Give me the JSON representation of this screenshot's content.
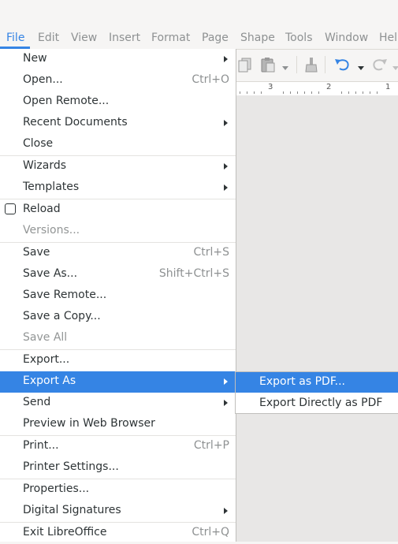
{
  "menubar": {
    "items": [
      "File",
      "Edit",
      "View",
      "Insert",
      "Format",
      "Page",
      "Shape",
      "Tools",
      "Window",
      "Hel"
    ]
  },
  "ruler": {
    "labels": [
      "3",
      "2",
      "1"
    ]
  },
  "file_menu": {
    "items": [
      {
        "label": "New",
        "submenu": true
      },
      {
        "label": "Open...",
        "accel": "Ctrl+O"
      },
      {
        "label": "Open Remote..."
      },
      {
        "label": "Recent Documents",
        "submenu": true
      },
      {
        "label": "Close"
      },
      {
        "label": "Wizards",
        "submenu": true
      },
      {
        "label": "Templates",
        "submenu": true
      },
      {
        "label": "Reload",
        "checkbox": true
      },
      {
        "label": "Versions...",
        "disabled": true
      },
      {
        "label": "Save",
        "accel": "Ctrl+S"
      },
      {
        "label": "Save As...",
        "accel": "Shift+Ctrl+S"
      },
      {
        "label": "Save Remote..."
      },
      {
        "label": "Save a Copy..."
      },
      {
        "label": "Save All",
        "disabled": true
      },
      {
        "label": "Export..."
      },
      {
        "label": "Export As",
        "submenu": true,
        "highlighted": true
      },
      {
        "label": "Send",
        "submenu": true
      },
      {
        "label": "Preview in Web Browser"
      },
      {
        "label": "Print...",
        "accel": "Ctrl+P"
      },
      {
        "label": "Printer Settings..."
      },
      {
        "label": "Properties..."
      },
      {
        "label": "Digital Signatures",
        "submenu": true
      },
      {
        "label": "Exit LibreOffice",
        "accel": "Ctrl+Q"
      }
    ]
  },
  "export_as_submenu": {
    "items": [
      {
        "label": "Export as PDF...",
        "highlighted": true
      },
      {
        "label": "Export Directly as PDF"
      }
    ]
  },
  "colors": {
    "accent": "#3584e4",
    "menu_bg": "#ffffff",
    "window_bg": "#f6f5f4"
  }
}
